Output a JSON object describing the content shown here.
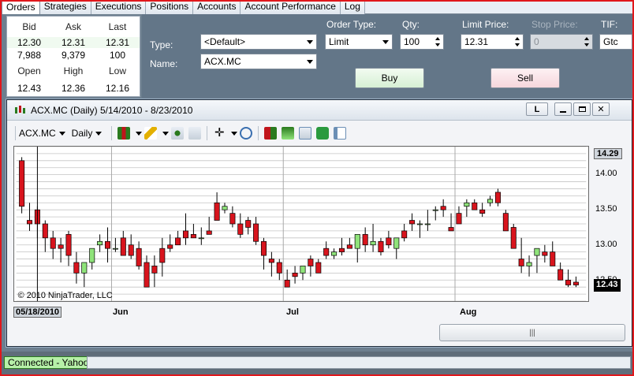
{
  "tabs": [
    "Orders",
    "Strategies",
    "Executions",
    "Positions",
    "Accounts",
    "Account Performance",
    "Log"
  ],
  "quote": {
    "headers1": [
      "Bid",
      "Ask",
      "Last"
    ],
    "row1": [
      "12.30",
      "12.31",
      "12.31"
    ],
    "row2": [
      "7,988",
      "9,379",
      "100"
    ],
    "headers2": [
      "Open",
      "High",
      "Low"
    ],
    "row3": [
      "12.43",
      "12.36",
      "12.16"
    ]
  },
  "order": {
    "type_label": "Type:",
    "type_value": "<Default>",
    "name_label": "Name:",
    "name_value": "ACX.MC",
    "order_type_label": "Order Type:",
    "order_type_value": "Limit",
    "qty_label": "Qty:",
    "qty_value": "100",
    "limit_label": "Limit Price:",
    "limit_value": "12.31",
    "stop_label": "Stop Price:",
    "stop_value": "0",
    "tif_label": "TIF:",
    "tif_value": "Gtc",
    "buy_label": "Buy",
    "sell_label": "Sell"
  },
  "chart_window": {
    "title": "ACX.MC (Daily)  5/14/2010 - 8/23/2010",
    "link_button": "L",
    "instrument": "ACX.MC",
    "period": "Daily",
    "copyright": "© 2010 NinjaTrader, LLC",
    "cursor_date": "05/18/2010",
    "month_labels": [
      "Jun",
      "Jul",
      "Aug"
    ],
    "y_labels": [
      "14.00",
      "13.50",
      "13.00",
      "12.50"
    ],
    "high_label": "14.29",
    "last_label": "12.43",
    "scroll_grip": "|||"
  },
  "chart_data": {
    "type": "candlestick",
    "title": "",
    "x": [
      "5/14",
      "5/17",
      "5/18",
      "5/19",
      "5/20",
      "5/21",
      "5/24",
      "5/25",
      "5/26",
      "5/27",
      "5/28",
      "5/31",
      "6/1",
      "6/2",
      "6/3",
      "6/4",
      "6/7",
      "6/8",
      "6/9",
      "6/10",
      "6/11",
      "6/14",
      "6/15",
      "6/16",
      "6/17",
      "6/18",
      "6/21",
      "6/22",
      "6/23",
      "6/24",
      "6/25",
      "6/28",
      "6/29",
      "6/30",
      "7/1",
      "7/2",
      "7/5",
      "7/6",
      "7/7",
      "7/8",
      "7/9",
      "7/12",
      "7/13",
      "7/14",
      "7/15",
      "7/16",
      "7/19",
      "7/20",
      "7/21",
      "7/22",
      "7/23",
      "7/26",
      "7/27",
      "7/28",
      "7/29",
      "7/30",
      "8/2",
      "8/3",
      "8/4",
      "8/5",
      "8/6",
      "8/9",
      "8/10",
      "8/11",
      "8/12",
      "8/13",
      "8/16",
      "8/17",
      "8/18",
      "8/19",
      "8/20",
      "8/23"
    ],
    "open": [
      14.2,
      13.35,
      13.5,
      13.3,
      13.1,
      13.0,
      13.15,
      12.75,
      12.6,
      12.75,
      13.0,
      13.05,
      12.95,
      13.1,
      13.0,
      12.95,
      12.75,
      12.7,
      12.95,
      13.0,
      13.1,
      13.2,
      13.15,
      13.1,
      13.2,
      13.6,
      13.5,
      13.45,
      13.3,
      13.35,
      13.3,
      13.05,
      12.8,
      12.75,
      12.5,
      12.6,
      12.6,
      12.8,
      12.75,
      12.95,
      12.85,
      12.95,
      13.0,
      12.95,
      13.15,
      13.0,
      13.05,
      13.1,
      12.95,
      13.2,
      13.35,
      13.3,
      13.3,
      13.5,
      13.55,
      13.25,
      13.45,
      13.55,
      13.6,
      13.5,
      13.6,
      13.75,
      13.45,
      13.25,
      12.8,
      12.7,
      12.85,
      12.9,
      12.9,
      12.65,
      12.5,
      12.47
    ],
    "high": [
      14.25,
      13.6,
      13.55,
      13.35,
      13.2,
      13.1,
      13.2,
      12.9,
      12.75,
      12.95,
      13.15,
      13.25,
      13.1,
      13.2,
      13.15,
      13.05,
      12.85,
      12.85,
      13.1,
      13.15,
      13.2,
      13.45,
      13.3,
      13.25,
      13.4,
      13.75,
      13.6,
      13.55,
      13.45,
      13.4,
      13.4,
      13.1,
      12.9,
      12.8,
      12.65,
      12.7,
      12.7,
      12.85,
      12.8,
      13.05,
      12.95,
      13.1,
      13.1,
      13.1,
      13.25,
      13.3,
      13.1,
      13.2,
      13.05,
      13.3,
      13.45,
      13.35,
      13.5,
      13.55,
      13.65,
      13.45,
      13.55,
      13.65,
      13.65,
      13.6,
      13.7,
      13.8,
      13.5,
      13.3,
      13.1,
      12.85,
      12.95,
      13.0,
      13.05,
      12.75,
      12.65,
      12.55
    ],
    "low": [
      13.45,
      13.2,
      13.1,
      12.9,
      12.8,
      12.75,
      12.7,
      12.45,
      12.4,
      12.65,
      12.9,
      12.75,
      12.9,
      12.85,
      12.8,
      12.65,
      12.45,
      12.4,
      12.55,
      12.9,
      13.0,
      13.0,
      13.1,
      13.0,
      13.15,
      13.35,
      13.45,
      13.25,
      13.1,
      13.15,
      13.0,
      12.65,
      12.55,
      12.5,
      12.4,
      12.45,
      12.5,
      12.55,
      12.6,
      12.8,
      12.8,
      12.85,
      12.95,
      12.75,
      12.9,
      12.9,
      12.85,
      12.95,
      12.8,
      13.05,
      13.2,
      13.1,
      13.2,
      13.35,
      13.4,
      13.2,
      13.35,
      13.4,
      13.5,
      13.4,
      13.55,
      13.55,
      13.2,
      12.95,
      12.6,
      12.55,
      12.6,
      12.75,
      12.75,
      12.6,
      12.4,
      12.4
    ],
    "close": [
      13.55,
      13.3,
      13.3,
      13.1,
      12.95,
      12.95,
      12.85,
      12.6,
      12.75,
      12.95,
      13.05,
      12.95,
      12.95,
      12.85,
      12.85,
      12.7,
      12.4,
      12.6,
      12.75,
      12.95,
      13.0,
      13.1,
      13.1,
      13.1,
      13.15,
      13.35,
      13.55,
      13.3,
      13.15,
      13.25,
      13.05,
      12.85,
      12.75,
      12.6,
      12.4,
      12.55,
      12.7,
      12.7,
      12.6,
      12.85,
      12.9,
      12.9,
      12.95,
      13.15,
      13.0,
      13.05,
      12.9,
      13.0,
      13.1,
      13.1,
      13.3,
      13.3,
      13.3,
      13.5,
      13.5,
      13.2,
      13.3,
      13.6,
      13.5,
      13.45,
      13.65,
      13.6,
      13.2,
      12.95,
      12.7,
      12.75,
      12.95,
      12.85,
      12.7,
      12.5,
      12.43,
      12.43
    ],
    "ylim": [
      12.2,
      14.4
    ],
    "grid": true,
    "up_color": "#8fe37a",
    "down_color": "#d8141d"
  },
  "status": {
    "connection": "Connected - Yahoo"
  },
  "colors": {
    "accent": "#637688",
    "frame": "#e0171b"
  }
}
